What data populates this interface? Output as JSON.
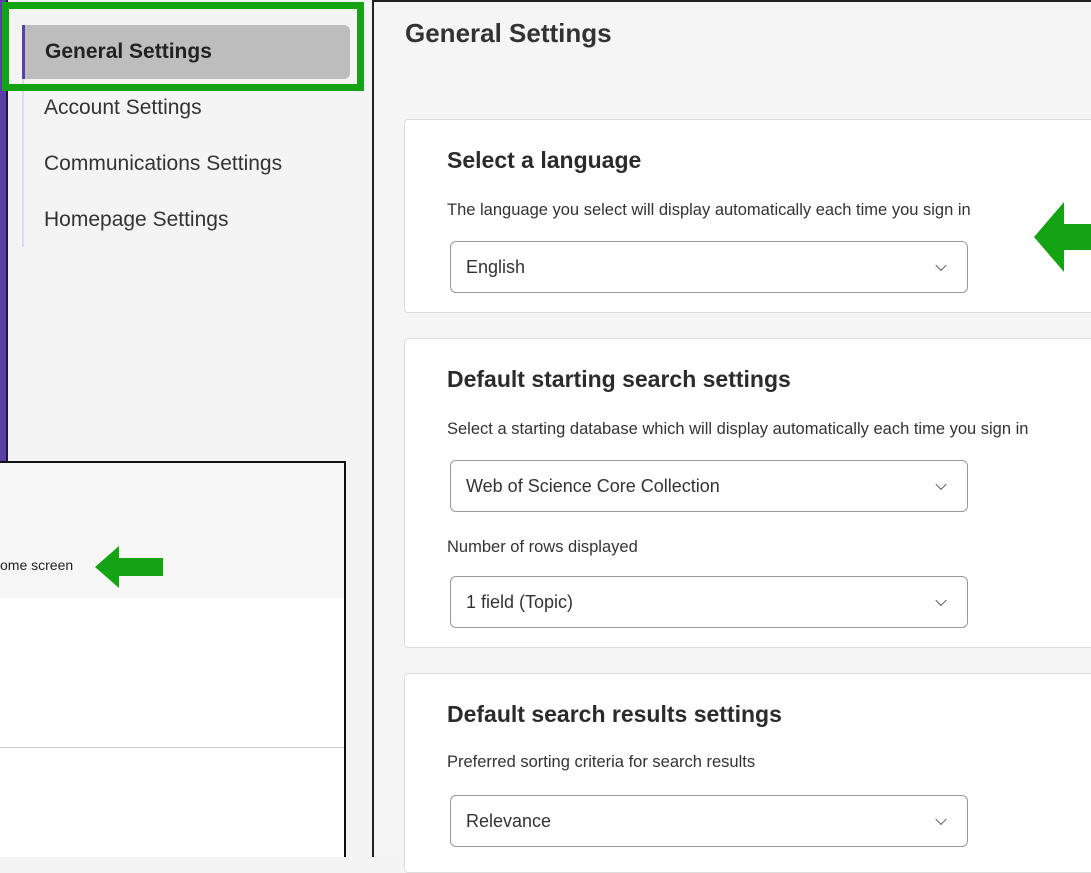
{
  "sidebar": {
    "items": [
      {
        "label": "General Settings",
        "active": true
      },
      {
        "label": "Account Settings",
        "active": false
      },
      {
        "label": "Communications Settings",
        "active": false
      },
      {
        "label": "Homepage Settings",
        "active": false
      }
    ]
  },
  "main": {
    "title": "General Settings",
    "language": {
      "title": "Select a language",
      "description": "The language you select will display automatically each time you sign in",
      "value": "English"
    },
    "search": {
      "title": "Default starting search settings",
      "description": "Select a starting database which will display automatically each time you sign in",
      "database_value": "Web of Science Core Collection",
      "rows_label": "Number of rows displayed",
      "rows_value": "1 field (Topic)"
    },
    "results": {
      "title": "Default search results settings",
      "description": "Preferred sorting criteria for search results",
      "sort_value": "Relevance"
    }
  },
  "inset": {
    "text": "ome screen"
  },
  "colors": {
    "highlight": "#13a313",
    "accent": "#5a3fa8"
  }
}
